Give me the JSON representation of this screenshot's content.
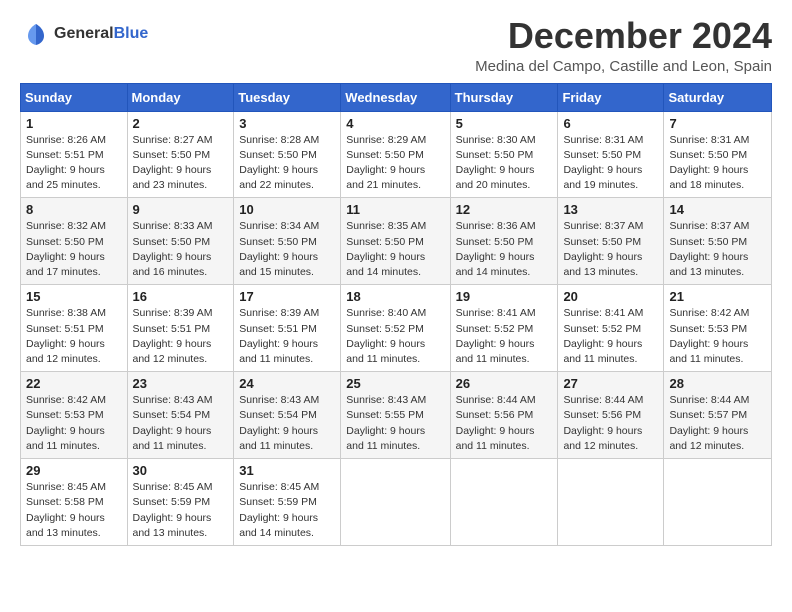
{
  "logo": {
    "text_general": "General",
    "text_blue": "Blue"
  },
  "title": "December 2024",
  "location": "Medina del Campo, Castille and Leon, Spain",
  "headers": [
    "Sunday",
    "Monday",
    "Tuesday",
    "Wednesday",
    "Thursday",
    "Friday",
    "Saturday"
  ],
  "weeks": [
    [
      {
        "day": "1",
        "sunrise": "Sunrise: 8:26 AM",
        "sunset": "Sunset: 5:51 PM",
        "daylight": "Daylight: 9 hours and 25 minutes."
      },
      {
        "day": "2",
        "sunrise": "Sunrise: 8:27 AM",
        "sunset": "Sunset: 5:50 PM",
        "daylight": "Daylight: 9 hours and 23 minutes."
      },
      {
        "day": "3",
        "sunrise": "Sunrise: 8:28 AM",
        "sunset": "Sunset: 5:50 PM",
        "daylight": "Daylight: 9 hours and 22 minutes."
      },
      {
        "day": "4",
        "sunrise": "Sunrise: 8:29 AM",
        "sunset": "Sunset: 5:50 PM",
        "daylight": "Daylight: 9 hours and 21 minutes."
      },
      {
        "day": "5",
        "sunrise": "Sunrise: 8:30 AM",
        "sunset": "Sunset: 5:50 PM",
        "daylight": "Daylight: 9 hours and 20 minutes."
      },
      {
        "day": "6",
        "sunrise": "Sunrise: 8:31 AM",
        "sunset": "Sunset: 5:50 PM",
        "daylight": "Daylight: 9 hours and 19 minutes."
      },
      {
        "day": "7",
        "sunrise": "Sunrise: 8:31 AM",
        "sunset": "Sunset: 5:50 PM",
        "daylight": "Daylight: 9 hours and 18 minutes."
      }
    ],
    [
      {
        "day": "8",
        "sunrise": "Sunrise: 8:32 AM",
        "sunset": "Sunset: 5:50 PM",
        "daylight": "Daylight: 9 hours and 17 minutes."
      },
      {
        "day": "9",
        "sunrise": "Sunrise: 8:33 AM",
        "sunset": "Sunset: 5:50 PM",
        "daylight": "Daylight: 9 hours and 16 minutes."
      },
      {
        "day": "10",
        "sunrise": "Sunrise: 8:34 AM",
        "sunset": "Sunset: 5:50 PM",
        "daylight": "Daylight: 9 hours and 15 minutes."
      },
      {
        "day": "11",
        "sunrise": "Sunrise: 8:35 AM",
        "sunset": "Sunset: 5:50 PM",
        "daylight": "Daylight: 9 hours and 14 minutes."
      },
      {
        "day": "12",
        "sunrise": "Sunrise: 8:36 AM",
        "sunset": "Sunset: 5:50 PM",
        "daylight": "Daylight: 9 hours and 14 minutes."
      },
      {
        "day": "13",
        "sunrise": "Sunrise: 8:37 AM",
        "sunset": "Sunset: 5:50 PM",
        "daylight": "Daylight: 9 hours and 13 minutes."
      },
      {
        "day": "14",
        "sunrise": "Sunrise: 8:37 AM",
        "sunset": "Sunset: 5:50 PM",
        "daylight": "Daylight: 9 hours and 13 minutes."
      }
    ],
    [
      {
        "day": "15",
        "sunrise": "Sunrise: 8:38 AM",
        "sunset": "Sunset: 5:51 PM",
        "daylight": "Daylight: 9 hours and 12 minutes."
      },
      {
        "day": "16",
        "sunrise": "Sunrise: 8:39 AM",
        "sunset": "Sunset: 5:51 PM",
        "daylight": "Daylight: 9 hours and 12 minutes."
      },
      {
        "day": "17",
        "sunrise": "Sunrise: 8:39 AM",
        "sunset": "Sunset: 5:51 PM",
        "daylight": "Daylight: 9 hours and 11 minutes."
      },
      {
        "day": "18",
        "sunrise": "Sunrise: 8:40 AM",
        "sunset": "Sunset: 5:52 PM",
        "daylight": "Daylight: 9 hours and 11 minutes."
      },
      {
        "day": "19",
        "sunrise": "Sunrise: 8:41 AM",
        "sunset": "Sunset: 5:52 PM",
        "daylight": "Daylight: 9 hours and 11 minutes."
      },
      {
        "day": "20",
        "sunrise": "Sunrise: 8:41 AM",
        "sunset": "Sunset: 5:52 PM",
        "daylight": "Daylight: 9 hours and 11 minutes."
      },
      {
        "day": "21",
        "sunrise": "Sunrise: 8:42 AM",
        "sunset": "Sunset: 5:53 PM",
        "daylight": "Daylight: 9 hours and 11 minutes."
      }
    ],
    [
      {
        "day": "22",
        "sunrise": "Sunrise: 8:42 AM",
        "sunset": "Sunset: 5:53 PM",
        "daylight": "Daylight: 9 hours and 11 minutes."
      },
      {
        "day": "23",
        "sunrise": "Sunrise: 8:43 AM",
        "sunset": "Sunset: 5:54 PM",
        "daylight": "Daylight: 9 hours and 11 minutes."
      },
      {
        "day": "24",
        "sunrise": "Sunrise: 8:43 AM",
        "sunset": "Sunset: 5:54 PM",
        "daylight": "Daylight: 9 hours and 11 minutes."
      },
      {
        "day": "25",
        "sunrise": "Sunrise: 8:43 AM",
        "sunset": "Sunset: 5:55 PM",
        "daylight": "Daylight: 9 hours and 11 minutes."
      },
      {
        "day": "26",
        "sunrise": "Sunrise: 8:44 AM",
        "sunset": "Sunset: 5:56 PM",
        "daylight": "Daylight: 9 hours and 11 minutes."
      },
      {
        "day": "27",
        "sunrise": "Sunrise: 8:44 AM",
        "sunset": "Sunset: 5:56 PM",
        "daylight": "Daylight: 9 hours and 12 minutes."
      },
      {
        "day": "28",
        "sunrise": "Sunrise: 8:44 AM",
        "sunset": "Sunset: 5:57 PM",
        "daylight": "Daylight: 9 hours and 12 minutes."
      }
    ],
    [
      {
        "day": "29",
        "sunrise": "Sunrise: 8:45 AM",
        "sunset": "Sunset: 5:58 PM",
        "daylight": "Daylight: 9 hours and 13 minutes."
      },
      {
        "day": "30",
        "sunrise": "Sunrise: 8:45 AM",
        "sunset": "Sunset: 5:59 PM",
        "daylight": "Daylight: 9 hours and 13 minutes."
      },
      {
        "day": "31",
        "sunrise": "Sunrise: 8:45 AM",
        "sunset": "Sunset: 5:59 PM",
        "daylight": "Daylight: 9 hours and 14 minutes."
      },
      null,
      null,
      null,
      null
    ]
  ]
}
